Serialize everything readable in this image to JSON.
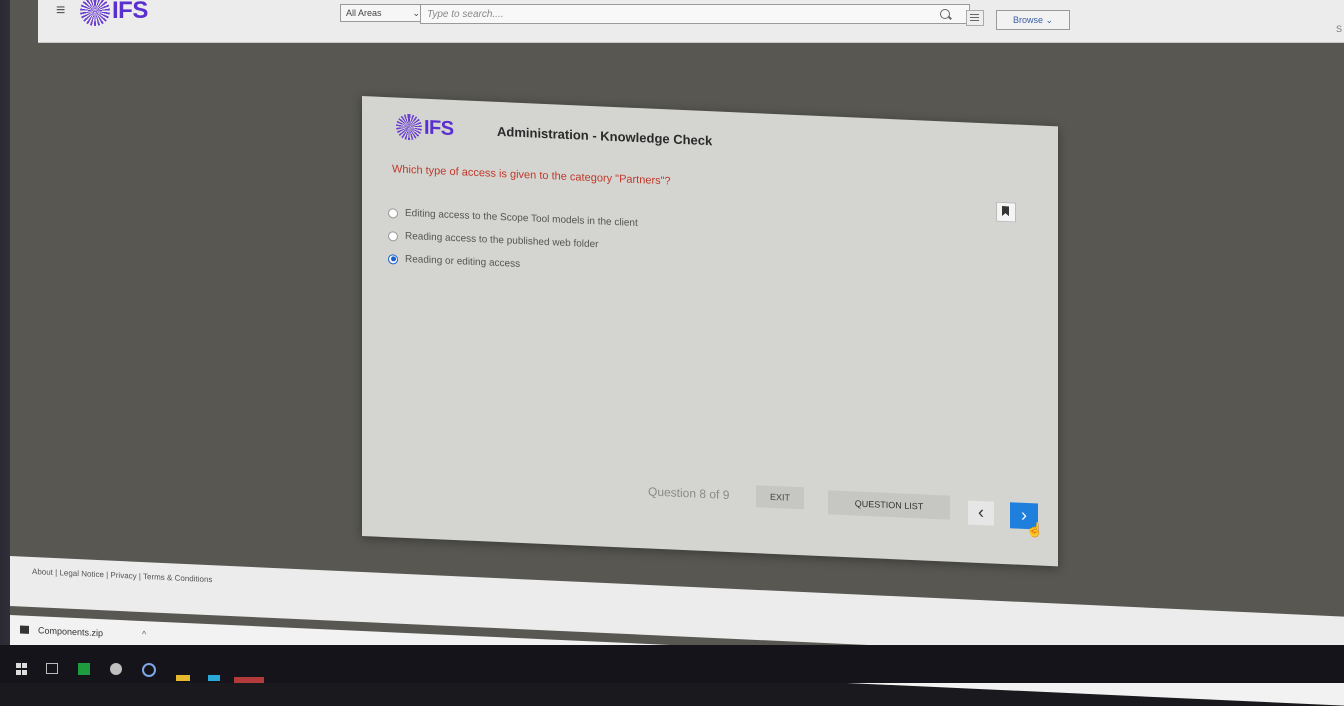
{
  "topbar": {
    "menu_glyph": "≡",
    "logo_text": "IFS",
    "area_select": "All Areas",
    "search_placeholder": "Type to search....",
    "browse_label": "Browse",
    "corner_glyph": "S"
  },
  "dialog": {
    "logo_text": "IFS",
    "title": "Administration - Knowledge Check",
    "question": "Which type of access is given to the category \"Partners\"?",
    "options": [
      {
        "label": "Editing access to the Scope Tool models in the client",
        "selected": false
      },
      {
        "label": "Reading access to the published web folder",
        "selected": false
      },
      {
        "label": "Reading or editing access",
        "selected": true
      }
    ],
    "question_counter": "Question 8 of 9",
    "exit_label": "EXIT",
    "question_list_label": "QUESTION LIST",
    "prev_glyph": "‹",
    "next_glyph": "›",
    "accent_color": "#1e7fdc",
    "question_color": "#c0392b"
  },
  "footer": {
    "links": "About | Legal Notice | Privacy | Terms & Conditions"
  },
  "download_bar": {
    "file_name": "Components.zip",
    "chevron": "^"
  },
  "icons": [
    "hamburger-icon",
    "search-icon",
    "filter-icon",
    "bookmark-icon",
    "chevron-left-icon",
    "chevron-right-icon",
    "windows-start-icon"
  ]
}
